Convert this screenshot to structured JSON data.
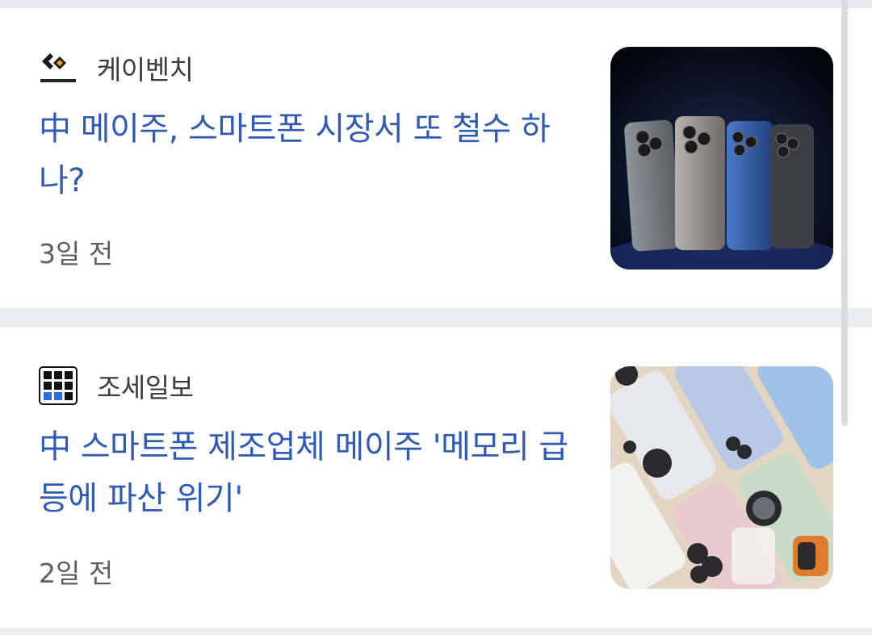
{
  "articles": [
    {
      "source": "케이벤치",
      "headline": "中 메이주, 스마트폰 시장서 또 철수 하나?",
      "time": "3일 전",
      "logo_icon": "kbench-logo",
      "thumbnail": "smartphone-lineup-image"
    },
    {
      "source": "조세일보",
      "headline": "中 스마트폰 제조업체 메이주 '메모리 급등에 파산 위기'",
      "time": "2일 전",
      "logo_icon": "joseilbo-logo",
      "thumbnail": "smartphone-flatlay-image"
    }
  ],
  "colors": {
    "headline": "#2f5bb7",
    "source": "#3c3c3c",
    "time": "#5f5f5f",
    "background": "#eceef2"
  }
}
